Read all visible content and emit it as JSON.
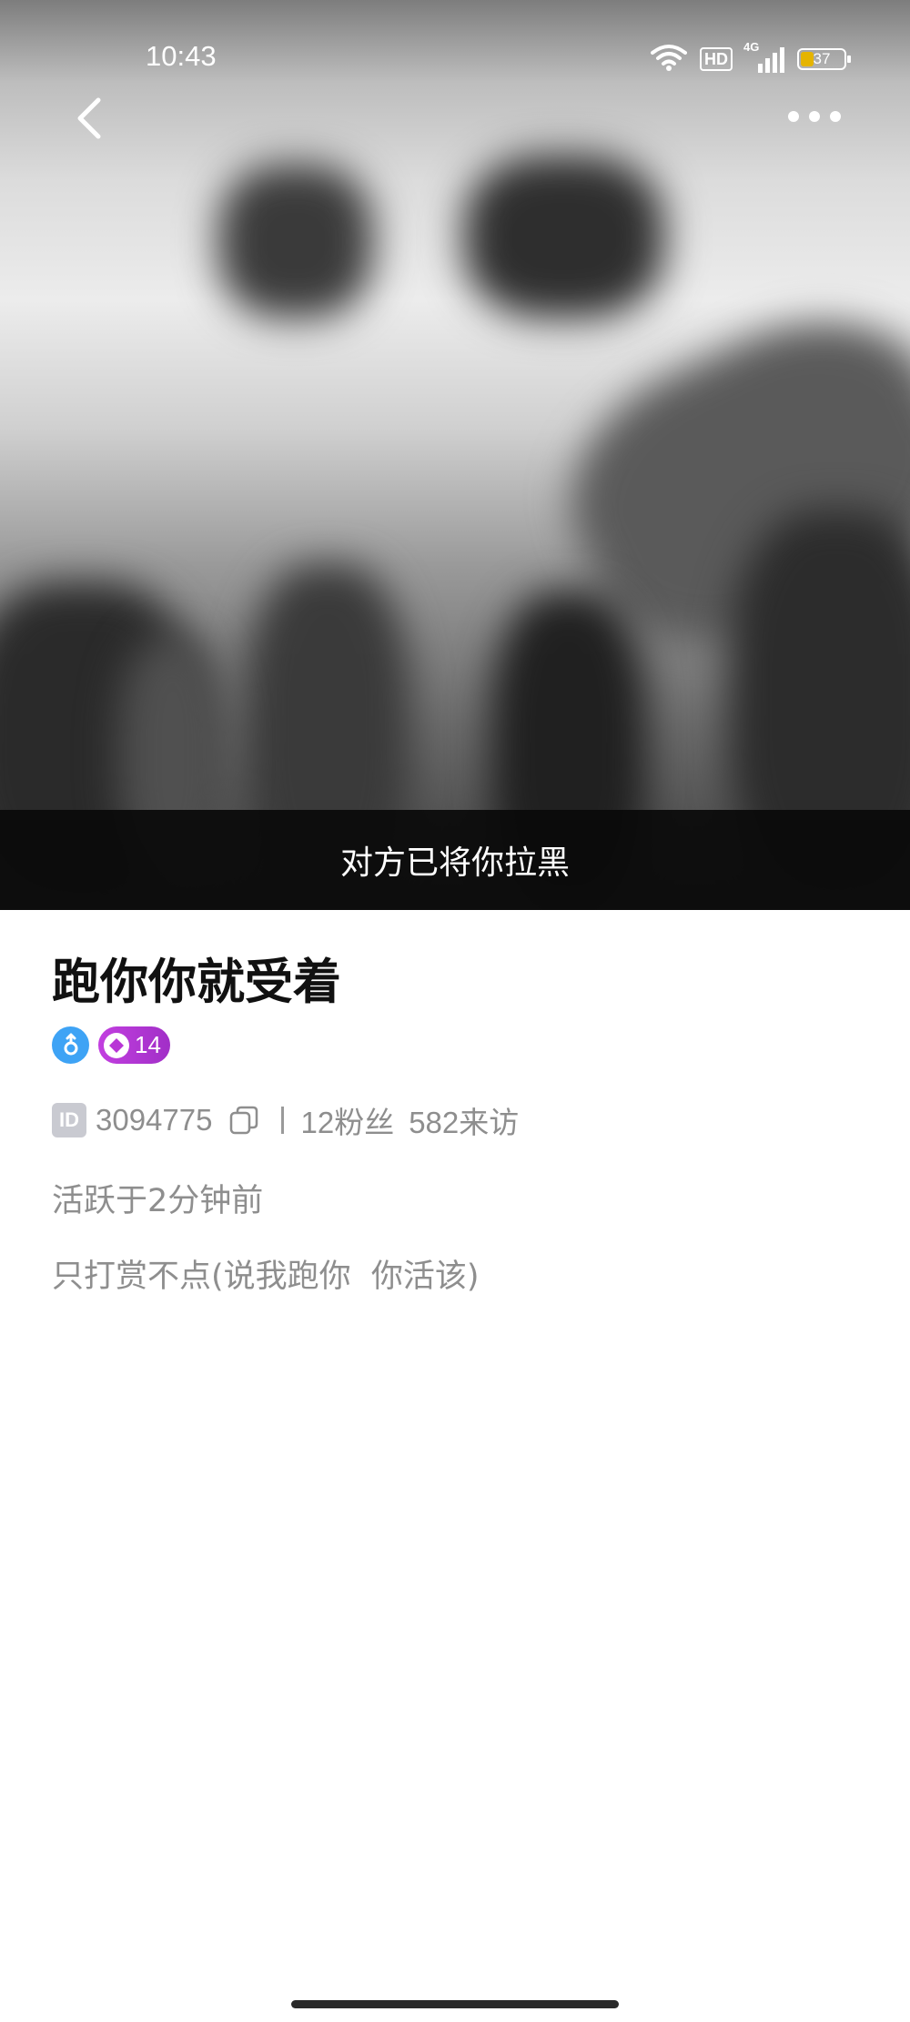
{
  "status_bar": {
    "time": "10:43",
    "network": "4G",
    "hd_label": "HD",
    "battery_level": "37",
    "battery_color": "#e5b400"
  },
  "header": {
    "back_icon": "chevron-left-icon",
    "more_icon": "more-dots-icon"
  },
  "cover": {
    "blocked_notice": "对方已将你拉黑"
  },
  "profile": {
    "nickname": "跑你你就受着",
    "gender_icon": "male-icon",
    "gender_color": "#3ea3f5",
    "level": "14",
    "level_color": "#b836d6",
    "id_label": "ID",
    "user_id": "3094775",
    "followers": "12粉丝",
    "visitors": "582来访",
    "active_status": "活跃于2分钟前",
    "bio": "只打赏不点(说我跑你  你活该)"
  }
}
